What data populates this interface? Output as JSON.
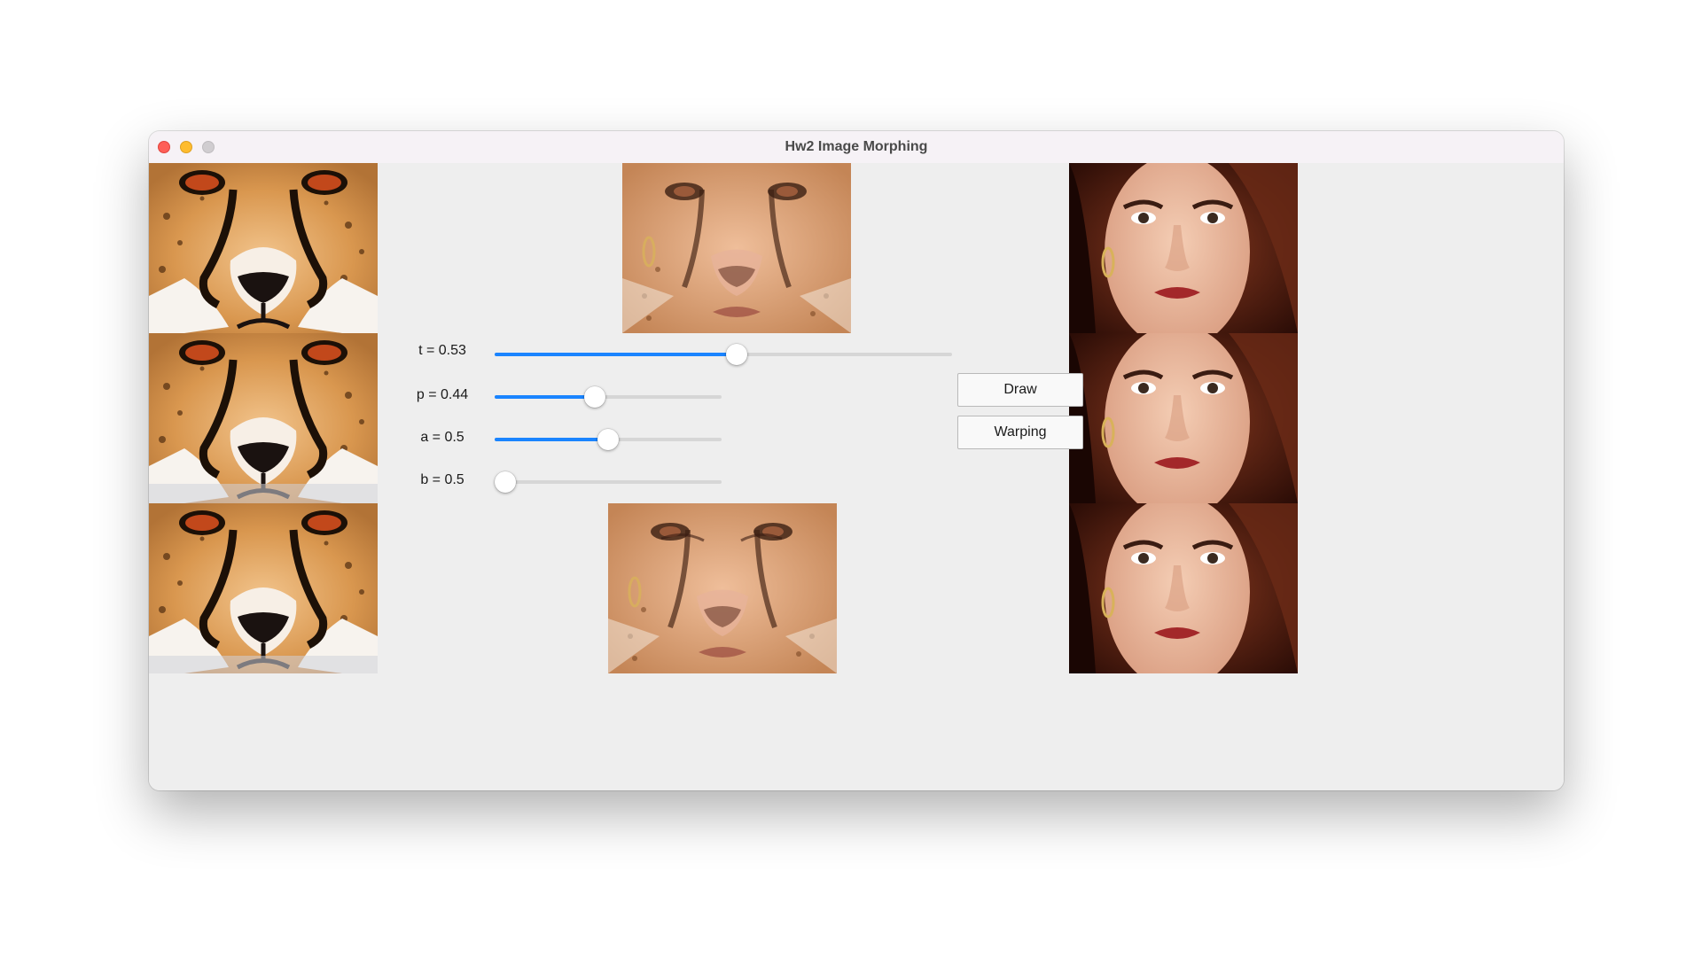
{
  "window": {
    "title": "Hw2 Image Morphing"
  },
  "params": {
    "t": {
      "label": "t = 0.53",
      "value": 0.53
    },
    "p": {
      "label": "p = 0.44",
      "value": 0.44
    },
    "a": {
      "label": "a = 0.5",
      "value": 0.5
    },
    "b": {
      "label": "b = 0.5",
      "value": 0.5,
      "slider_position": 0.0
    }
  },
  "buttons": {
    "draw": "Draw",
    "warping": "Warping"
  },
  "colors": {
    "accent": "#1a84ff",
    "track": "#d6d6d6"
  },
  "images": {
    "left": [
      "cheetah-face",
      "cheetah-face-warped",
      "cheetah-face-warped"
    ],
    "right": [
      "woman-face",
      "woman-face-warped",
      "woman-face-warped"
    ],
    "center_top": "morph-preview",
    "center_bottom": "morph-result"
  }
}
